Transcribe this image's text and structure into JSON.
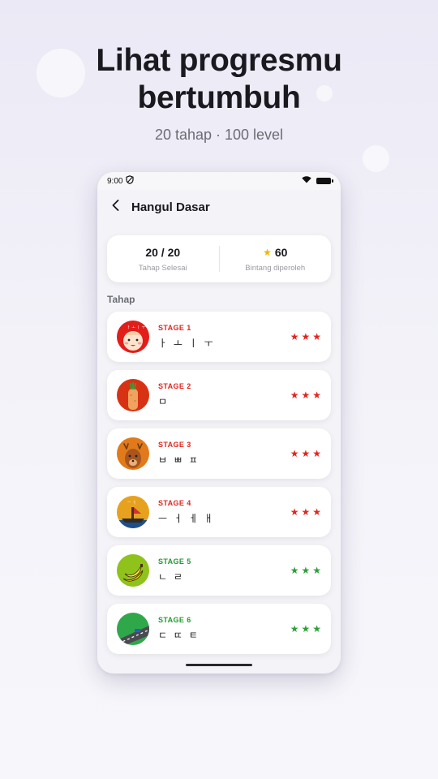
{
  "promo": {
    "headline_line1": "Lihat progresmu",
    "headline_line2": "bertumbuh",
    "subline": "20 tahap · 100 level"
  },
  "statusbar": {
    "time": "9:00"
  },
  "appbar": {
    "title": "Hangul Dasar"
  },
  "summary": {
    "completed_value": "20 / 20",
    "completed_label": "Tahap Selesai",
    "stars_value": "60",
    "stars_label": "Bintang diperoleh"
  },
  "section_label": "Tahap",
  "stages": [
    {
      "name": "STAGE 1",
      "chars": "ㅏ ㅗ ㅣ ㅜ",
      "stars": 3,
      "color": "#e0261f",
      "icon": "baby-icon"
    },
    {
      "name": "STAGE 2",
      "chars": "ㅁ",
      "stars": 3,
      "color": "#e0261f",
      "icon": "carrot-icon"
    },
    {
      "name": "STAGE 3",
      "chars": "ㅂ ㅃ ㅍ",
      "stars": 3,
      "color": "#e0261f",
      "icon": "deer-icon"
    },
    {
      "name": "STAGE 4",
      "chars": "ㅡ ㅓ ㅔ ㅐ",
      "stars": 3,
      "color": "#e0261f",
      "icon": "boat-icon"
    },
    {
      "name": "STAGE 5",
      "chars": "ㄴ ㄹ",
      "stars": 3,
      "color": "#1f9a2e",
      "icon": "banana-icon"
    },
    {
      "name": "STAGE 6",
      "chars": "ㄷ ㄸ ㅌ",
      "stars": 3,
      "color": "#1f9a2e",
      "icon": "road-icon"
    }
  ]
}
